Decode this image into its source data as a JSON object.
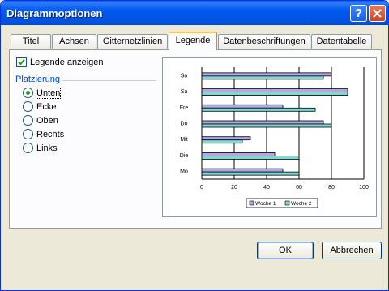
{
  "window": {
    "title": "Diagrammoptionen"
  },
  "tabs": [
    {
      "label": "Titel"
    },
    {
      "label": "Achsen"
    },
    {
      "label": "Gitternetzlinien"
    },
    {
      "label": "Legende",
      "active": true
    },
    {
      "label": "Datenbeschriftungen"
    },
    {
      "label": "Datentabelle"
    }
  ],
  "legend_options": {
    "show_legend_label": "Legende anzeigen",
    "show_legend_checked": true,
    "placement_group_label": "Platzierung",
    "placements": [
      {
        "label": "Unten",
        "selected": true
      },
      {
        "label": "Ecke",
        "selected": false
      },
      {
        "label": "Oben",
        "selected": false
      },
      {
        "label": "Rechts",
        "selected": false
      },
      {
        "label": "Links",
        "selected": false
      }
    ]
  },
  "buttons": {
    "ok": "OK",
    "cancel": "Abbrechen"
  },
  "colors": {
    "title_bar": "#0058ee",
    "series1": "#b3a7e8",
    "series2": "#7ed8d4",
    "selected_radio": "#21a121"
  },
  "chart_data": {
    "type": "bar",
    "orientation": "horizontal",
    "categories": [
      "So",
      "Sa",
      "Fre",
      "Do",
      "Mit",
      "Die",
      "Mo"
    ],
    "series": [
      {
        "name": "Woche 1",
        "values": [
          80,
          90,
          50,
          75,
          30,
          45,
          50
        ]
      },
      {
        "name": "Woche 2",
        "values": [
          75,
          90,
          70,
          80,
          25,
          60,
          60
        ]
      }
    ],
    "xticks": [
      "0",
      "20",
      "40",
      "60",
      "80",
      "100"
    ],
    "xlim": [
      0,
      100
    ],
    "grid": true,
    "legend_position": "bottom"
  }
}
